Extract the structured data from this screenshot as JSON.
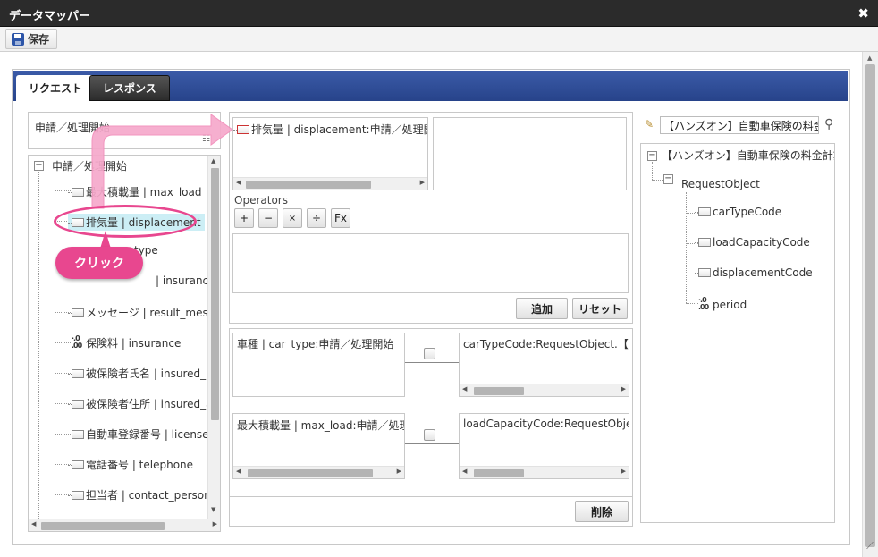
{
  "window": {
    "title": "データマッパー"
  },
  "toolbar": {
    "save_label": "保存"
  },
  "tabs": [
    {
      "label": "リクエスト",
      "active": true
    },
    {
      "label": "レスポンス",
      "active": false
    }
  ],
  "source": {
    "header": "申請／処理開始",
    "tree_root": "申請／処理開始",
    "items": [
      {
        "label": "最大積載量 | max_load",
        "type": "field"
      },
      {
        "label": "排気量 | displacement",
        "type": "field",
        "selected": true
      },
      {
        "label": "type",
        "type": "field"
      },
      {
        "label": "| insurance_term",
        "type": "field"
      },
      {
        "label": "メッセージ | result_message",
        "type": "field"
      },
      {
        "label": "保険料 | insurance",
        "type": "number"
      },
      {
        "label": "被保険者氏名 | insured_name",
        "type": "field"
      },
      {
        "label": "被保険者住所 | insured_address",
        "type": "field"
      },
      {
        "label": "自動車登録番号 | license_",
        "type": "field"
      },
      {
        "label": "電話番号 | telephone",
        "type": "field"
      },
      {
        "label": "担当者 | contact_personname",
        "type": "field"
      }
    ]
  },
  "editor": {
    "expression": "排気量 | displacement:申請／処理開始",
    "operators_label": "Operators",
    "operators": [
      "+",
      "−",
      "×",
      "÷",
      "Fx"
    ],
    "add_label": "追加",
    "reset_label": "リセット",
    "delete_label": "削除"
  },
  "mappings": [
    {
      "source": "車種 | car_type:申請／処理開始",
      "target": "carTypeCode:RequestObject.【ハン"
    },
    {
      "source": "最大積載量 | max_load:申請／処理開",
      "target": "loadCapacityCode:RequestObject"
    }
  ],
  "target": {
    "search_value": "【ハンズオン】自動車保険の料金計",
    "tree_root": "【ハンズオン】自動車保険の料金計算",
    "object": "RequestObject",
    "items": [
      {
        "label": "carTypeCode",
        "type": "field"
      },
      {
        "label": "loadCapacityCode",
        "type": "field"
      },
      {
        "label": "displacementCode",
        "type": "field"
      },
      {
        "label": "period",
        "type": "number"
      }
    ]
  },
  "annotation": {
    "click_label": "クリック"
  },
  "icons": {
    "close": "close-icon",
    "save": "floppy-disk-icon",
    "search": "magnifier-icon",
    "edit": "pencil-icon",
    "field": "field-icon",
    "number": "number-icon"
  },
  "colors": {
    "tab_bar": "#2f4d98",
    "highlight": "#e8478f",
    "selected_bg": "#cceef5"
  }
}
